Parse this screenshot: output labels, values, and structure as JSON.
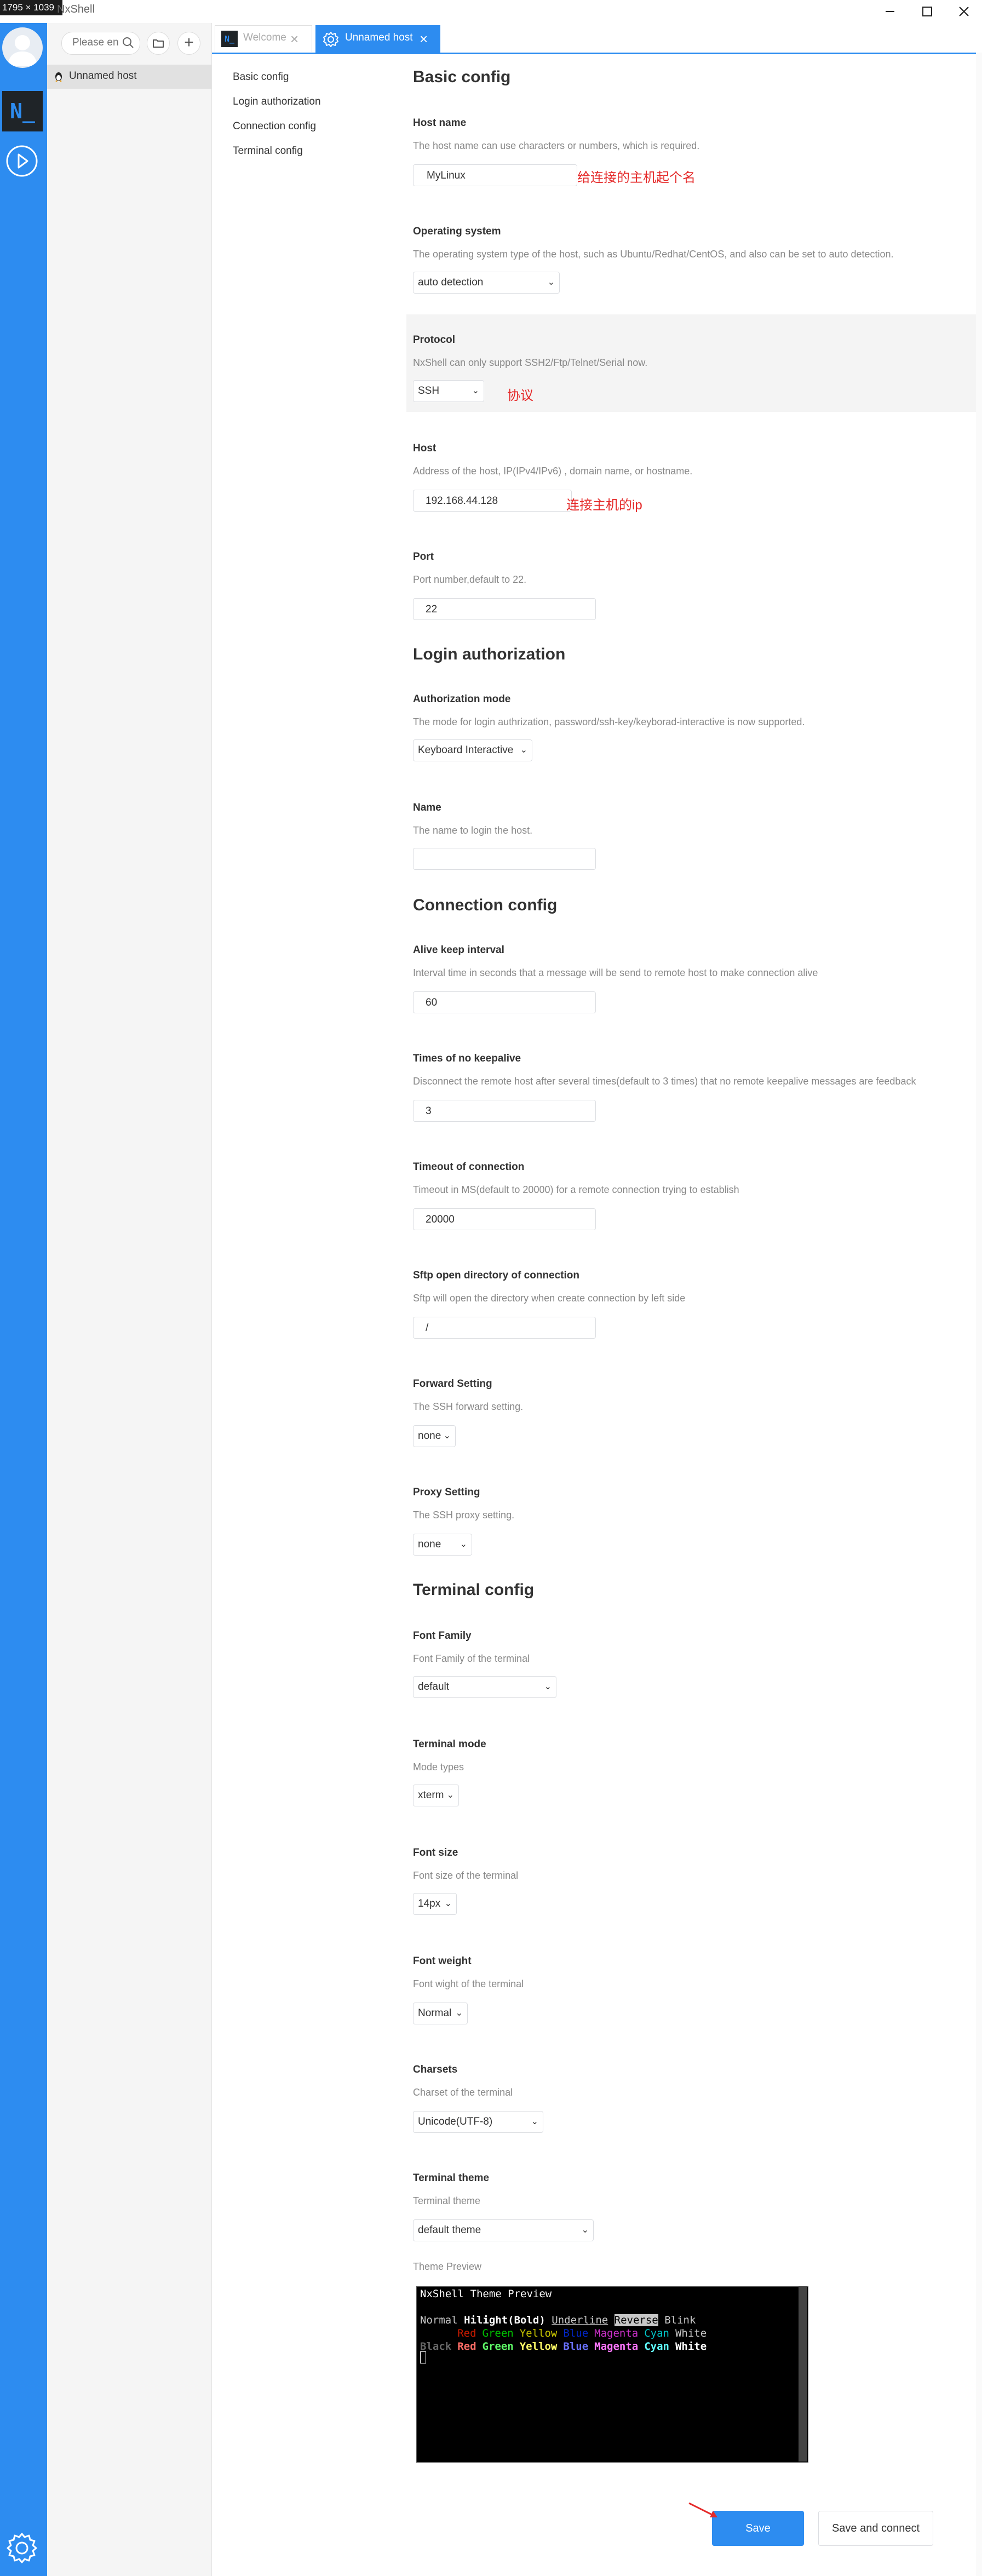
{
  "window": {
    "dimension_label": "1795 × 1039",
    "app_title": "NxShell"
  },
  "sidebar": {
    "search_placeholder": "Please en",
    "hosts": [
      {
        "label": "Unnamed host"
      }
    ]
  },
  "tabs": [
    {
      "label": "Welcome",
      "active": false
    },
    {
      "label": "Unnamed host",
      "active": true
    }
  ],
  "nav": [
    {
      "label": "Basic config"
    },
    {
      "label": "Login authorization"
    },
    {
      "label": "Connection config"
    },
    {
      "label": "Terminal config"
    }
  ],
  "form": {
    "basic_title": "Basic config",
    "host_name": {
      "title": "Host name",
      "desc": "The host name can use characters or numbers, which is required.",
      "value": "MyLinux",
      "annotation": "给连接的主机起个名"
    },
    "os": {
      "title": "Operating system",
      "desc": "The operating system type of the host, such as Ubuntu/Redhat/CentOS, and also can be set to auto detection.",
      "value": "auto detection"
    },
    "protocol": {
      "title": "Protocol",
      "desc": "NxShell can only support SSH2/Ftp/Telnet/Serial now.",
      "value": "SSH",
      "annotation": "协议"
    },
    "host": {
      "title": "Host",
      "desc": "Address of the host, IP(IPv4/IPv6)  , domain name, or hostname.",
      "value": "192.168.44.128",
      "annotation": "连接主机的ip"
    },
    "port": {
      "title": "Port",
      "desc": "Port number,default to 22.",
      "value": "22"
    },
    "login_title": "Login authorization",
    "auth_mode": {
      "title": "Authorization mode",
      "desc": "The mode for login authrization, password/ssh-key/keyborad-interactive is now supported.",
      "value": "Keyboard Interactive"
    },
    "name": {
      "title": "Name",
      "desc": "The name to login the host.",
      "value": ""
    },
    "connection_title": "Connection config",
    "alive": {
      "title": "Alive keep interval",
      "desc": "Interval time in seconds that a message will be send to remote host to make connection alive",
      "value": "60"
    },
    "no_keepalive": {
      "title": "Times of no keepalive",
      "desc": "Disconnect the remote host after several times(default to 3 times) that no remote keepalive messages are feedback",
      "value": "3"
    },
    "timeout": {
      "title": "Timeout of connection",
      "desc": "Timeout in MS(default to 20000) for a remote connection trying to establish",
      "value": "20000"
    },
    "sftp_dir": {
      "title": "Sftp open directory of connection",
      "desc": "Sftp will open the directory when create connection by left side",
      "value": "/"
    },
    "forward": {
      "title": "Forward Setting",
      "desc": "The SSH forward setting.",
      "value": "none"
    },
    "proxy": {
      "title": "Proxy Setting",
      "desc": "The SSH proxy setting.",
      "value": "none"
    },
    "terminal_title": "Terminal config",
    "font_family": {
      "title": "Font Family",
      "desc": "Font Family of the terminal",
      "value": "default"
    },
    "terminal_mode": {
      "title": "Terminal mode",
      "desc": "Mode types",
      "value": "xterm"
    },
    "font_size": {
      "title": "Font size",
      "desc": "Font size of the terminal",
      "value": "14px"
    },
    "font_weight": {
      "title": "Font weight",
      "desc": "Font wight of the terminal",
      "value": "Normal"
    },
    "charsets": {
      "title": "Charsets",
      "desc": "Charset of the terminal",
      "value": "Unicode(UTF-8)"
    },
    "theme": {
      "title": "Terminal theme",
      "desc": "Terminal theme",
      "value": "default theme"
    },
    "preview_label": "Theme Preview"
  },
  "preview": {
    "title": "NxShell Theme Preview",
    "styles": {
      "normal": "Normal",
      "bold": "Hilight(Bold)",
      "underline": "Underline",
      "reverse": "Reverse",
      "blink": "Blink"
    },
    "colors": [
      "Black",
      "Red",
      "Green",
      "Yellow",
      "Blue",
      "Magenta",
      "Cyan",
      "White"
    ],
    "normal_colors": [
      "#000000",
      "#c91b00",
      "#00c200",
      "#c7c400",
      "#0225c7",
      "#c930c7",
      "#00c5c7",
      "#c7c7c7"
    ],
    "bright_colors": [
      "#686868",
      "#ff6e67",
      "#5ffa68",
      "#fffc67",
      "#6871ff",
      "#ff77ff",
      "#60fdff",
      "#ffffff"
    ]
  },
  "buttons": {
    "save": "Save",
    "save_connect": "Save and connect"
  },
  "colors": {
    "accent": "#2d8cf0",
    "annotation": "#e52a2a"
  }
}
